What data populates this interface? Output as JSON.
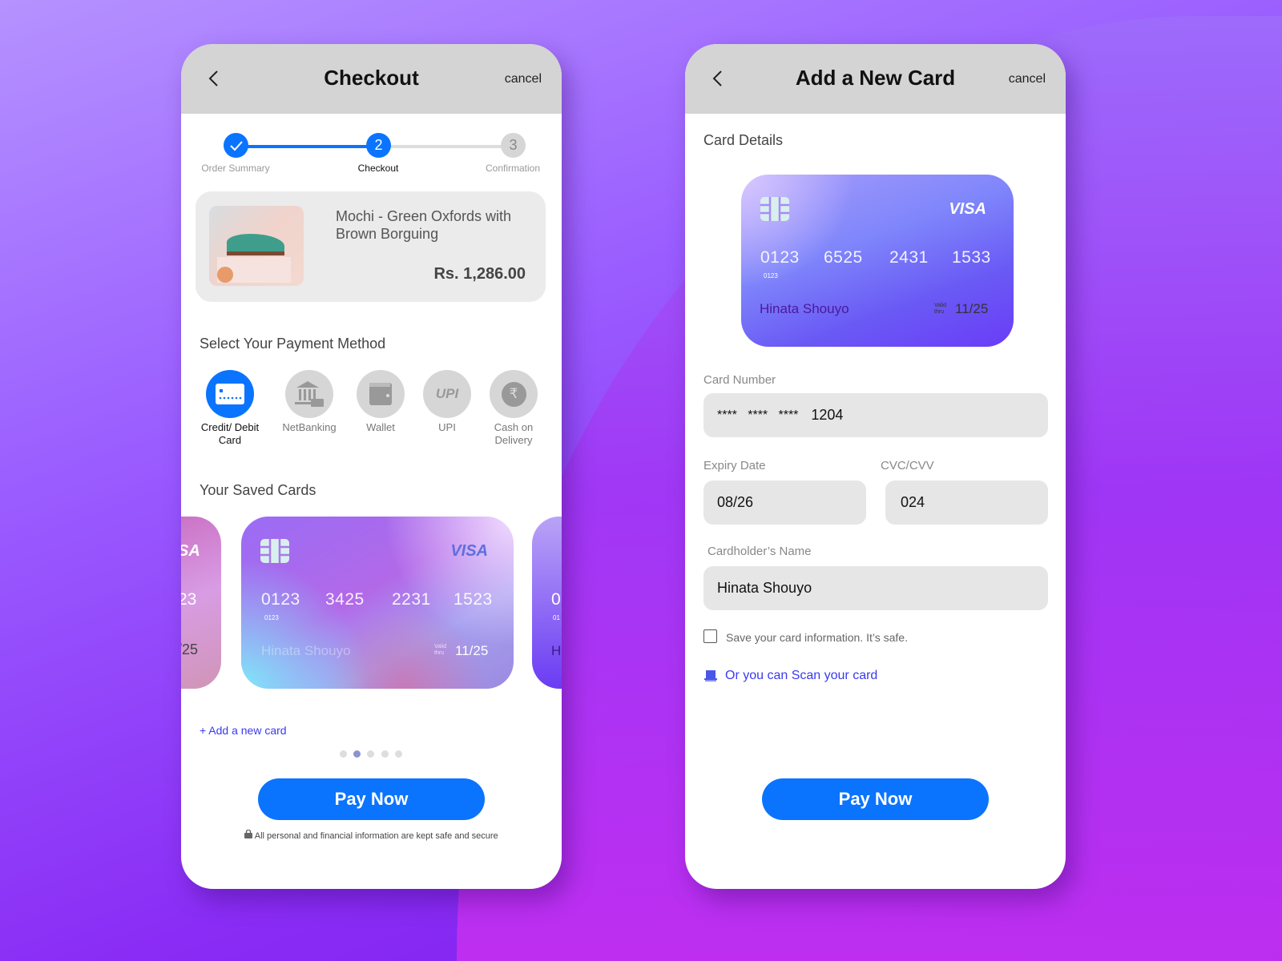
{
  "colors": {
    "primary": "#0a74ff",
    "link": "#3a3af0",
    "header": "#d4d4d4",
    "field": "#e6e6e6"
  },
  "checkout": {
    "title": "Checkout",
    "cancel": "cancel",
    "steps": [
      {
        "label": "Order Summary",
        "value": "",
        "state": "done"
      },
      {
        "label": "Checkout",
        "value": "2",
        "state": "active"
      },
      {
        "label": "Confirmation",
        "value": "3",
        "state": "pending"
      }
    ],
    "product": {
      "brand": "Mochi",
      "name": " - Green Oxfords with Brown Borguing",
      "price": "Rs. 1,286.00"
    },
    "payment_heading": "Select Your Payment Method",
    "methods": [
      {
        "label": "Credit/ Debit Card",
        "icon": "credit-card-icon",
        "selected": true
      },
      {
        "label": "NetBanking",
        "icon": "bank-icon"
      },
      {
        "label": "Wallet",
        "icon": "wallet-icon"
      },
      {
        "label": "UPI",
        "icon": "upi-icon",
        "glyph": "UPI"
      },
      {
        "label": "Cash on Delivery",
        "icon": "rupee-icon",
        "glyph": "₹"
      }
    ],
    "saved_heading": "Your Saved Cards",
    "saved_card": {
      "brand": "VISA",
      "groups": [
        "0123",
        "3425",
        "2231",
        "1523"
      ],
      "small": "0123",
      "name": "Hinata Shouyo",
      "valid_label": "Valid thru",
      "expiry": "11/25"
    },
    "left_card": {
      "brand_fragment": "SA",
      "num_fragment": "23",
      "exp_fragment": "/25"
    },
    "right_card": {
      "num_fragment": "0",
      "small_fragment": "01",
      "name_fragment": "H"
    },
    "carousel": {
      "count": 5,
      "active": 2
    },
    "add_card": "+ Add a new card",
    "pay": "Pay Now",
    "secure_note": "All personal and financial information are kept safe and secure"
  },
  "add_card": {
    "title": "Add a New Card",
    "cancel": "cancel",
    "section": "Card Details",
    "card": {
      "brand": "VISA",
      "groups": [
        "0123",
        "6525",
        "2431",
        "1533"
      ],
      "small": "0123",
      "name": "Hinata Shouyo",
      "valid_label": "Valid thru",
      "expiry": "11/25"
    },
    "card_number_label": "Card Number",
    "card_number_mask": "****   ****   ****",
    "card_number_last": "1204",
    "expiry_label": "Expiry Date",
    "expiry": "08/26",
    "cvv_label": "CVC/CVV",
    "cvv": "024",
    "name_label": "Cardholder’s Name",
    "name": "Hinata Shouyo",
    "save_label": "Save your card information. It’s safe.",
    "save_checked": false,
    "scan_link": "Or you can Scan your card",
    "pay": "Pay Now"
  }
}
